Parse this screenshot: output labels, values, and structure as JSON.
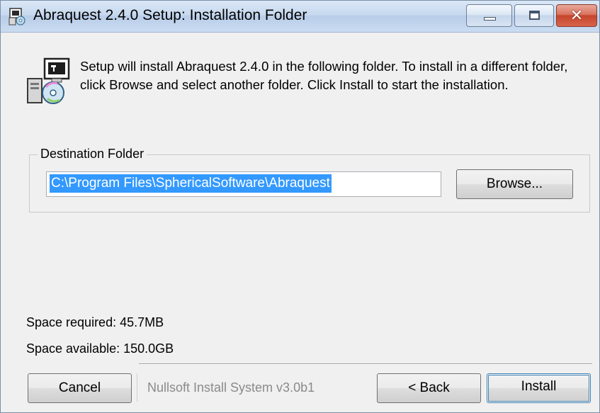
{
  "window": {
    "title": "Abraquest 2.4.0 Setup: Installation Folder",
    "controls": {
      "minimize_icon": "minimize-icon",
      "maximize_icon": "maximize-icon",
      "close_glyph": "✕"
    }
  },
  "intro": {
    "text": "Setup will install Abraquest 2.4.0 in the following folder. To install in a different folder, click Browse and select another folder. Click Install to start the installation."
  },
  "destination": {
    "group_label": "Destination Folder",
    "path_value": "C:\\Program Files\\SphericalSoftware\\Abraquest",
    "browse_label": "Browse..."
  },
  "space": {
    "required": "Space required: 45.7MB",
    "available": "Space available: 150.0GB"
  },
  "footer": {
    "branding": "Nullsoft Install System v3.0b1",
    "cancel_label": "Cancel",
    "back_label": "< Back",
    "install_label": "Install"
  },
  "colors": {
    "selection": "#3399ff",
    "close_button": "#c6452c",
    "titlebar": "#c7d9ef"
  }
}
